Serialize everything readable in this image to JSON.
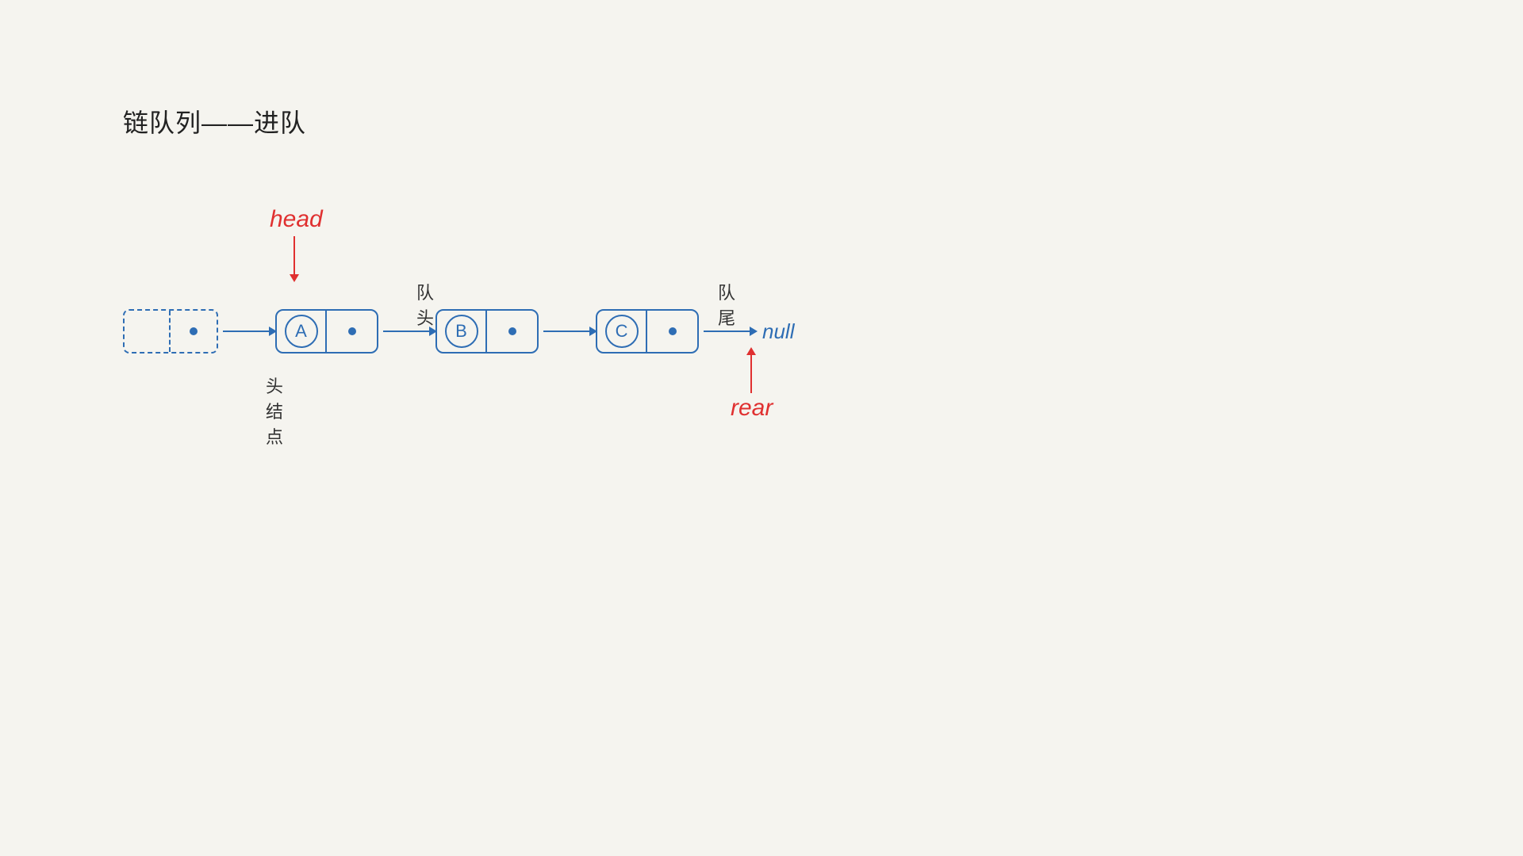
{
  "title": "链队列——进队",
  "head_label": "head",
  "rear_label": "rear",
  "head_node_label": "头结点",
  "duitou_label": "队头",
  "duiwei_label": "队尾",
  "null_text": "null",
  "nodes": [
    {
      "id": "A",
      "label": "A"
    },
    {
      "id": "B",
      "label": "B"
    },
    {
      "id": "C",
      "label": "C"
    }
  ],
  "colors": {
    "blue": "#2e6db4",
    "red": "#e03030",
    "bg": "#f5f4ef",
    "text": "#333"
  }
}
